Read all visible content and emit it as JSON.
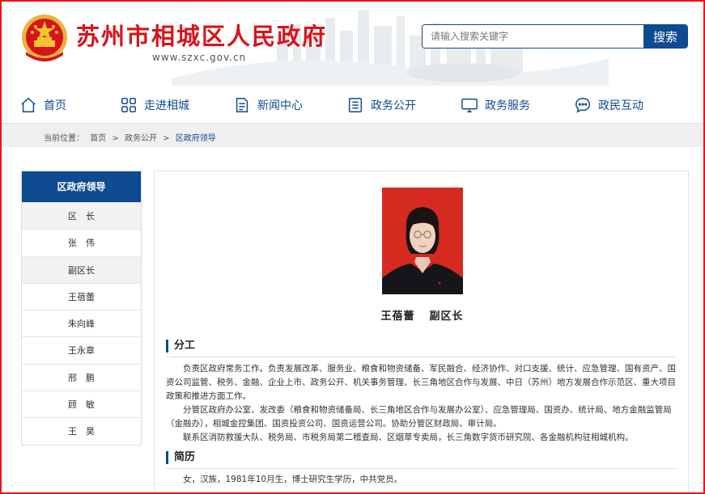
{
  "header": {
    "site_title": "苏州市相城区人民政府",
    "site_url": "www.szxc.gov.cn",
    "search_placeholder": "请输入搜索关键字",
    "search_button": "搜索"
  },
  "nav": {
    "items": [
      {
        "label": "首页",
        "icon": "home-icon"
      },
      {
        "label": "走进相城",
        "icon": "grid-icon"
      },
      {
        "label": "新闻中心",
        "icon": "document-icon"
      },
      {
        "label": "政务公开",
        "icon": "list-icon"
      },
      {
        "label": "政务服务",
        "icon": "monitor-icon"
      },
      {
        "label": "政民互动",
        "icon": "chat-icon"
      }
    ]
  },
  "breadcrumb": {
    "prefix": "当前位置：",
    "items": [
      "首页",
      "政务公开",
      "区政府领导"
    ],
    "separator": ">"
  },
  "sidebar": {
    "title": "区政府领导",
    "items": [
      {
        "label": "区　长",
        "type": "group"
      },
      {
        "label": "张　伟",
        "type": "person"
      },
      {
        "label": "副区长",
        "type": "group"
      },
      {
        "label": "王蓓蕾",
        "type": "person"
      },
      {
        "label": "朱向峰",
        "type": "person"
      },
      {
        "label": "王永章",
        "type": "person"
      },
      {
        "label": "邢　鹏",
        "type": "person"
      },
      {
        "label": "顾　敏",
        "type": "person"
      },
      {
        "label": "王　昊",
        "type": "person"
      }
    ]
  },
  "profile": {
    "name": "王蓓蕾",
    "position": "副区长",
    "duties_title": "分工",
    "duties": [
      "负责区政府常务工作。负责发展改革、服务业、粮食和物资储备、军民融合、经济协作、对口支援、统计、应急管理、国有资产、国资公司监管、税务、金融、企业上市、政务公开、机关事务管理、长三角地区合作与发展、中日（苏州）地方发展合作示范区、重大项目政策和推进方面工作。",
      "分管区政府办公室、发改委（粮食和物资储备局、长三角地区合作与发展办公室）、应急管理局、国资办、统计局、地方金融监管局（金融办），相城金控集团、国资投资公司、国资运营公司。协助分管区财政局、审计局。",
      "联系区消防救援大队、税务局、市税务局第二稽查局、区烟草专卖局，长三角数字货币研究院、各金融机构驻相城机构。"
    ],
    "resume_title": "简历",
    "resume": "女，汉族，1981年10月生，博士研究生学历，中共党员。"
  },
  "colors": {
    "brand_red": "#d7141c",
    "brand_blue": "#0e4a90",
    "frame_red": "#e8141b"
  }
}
